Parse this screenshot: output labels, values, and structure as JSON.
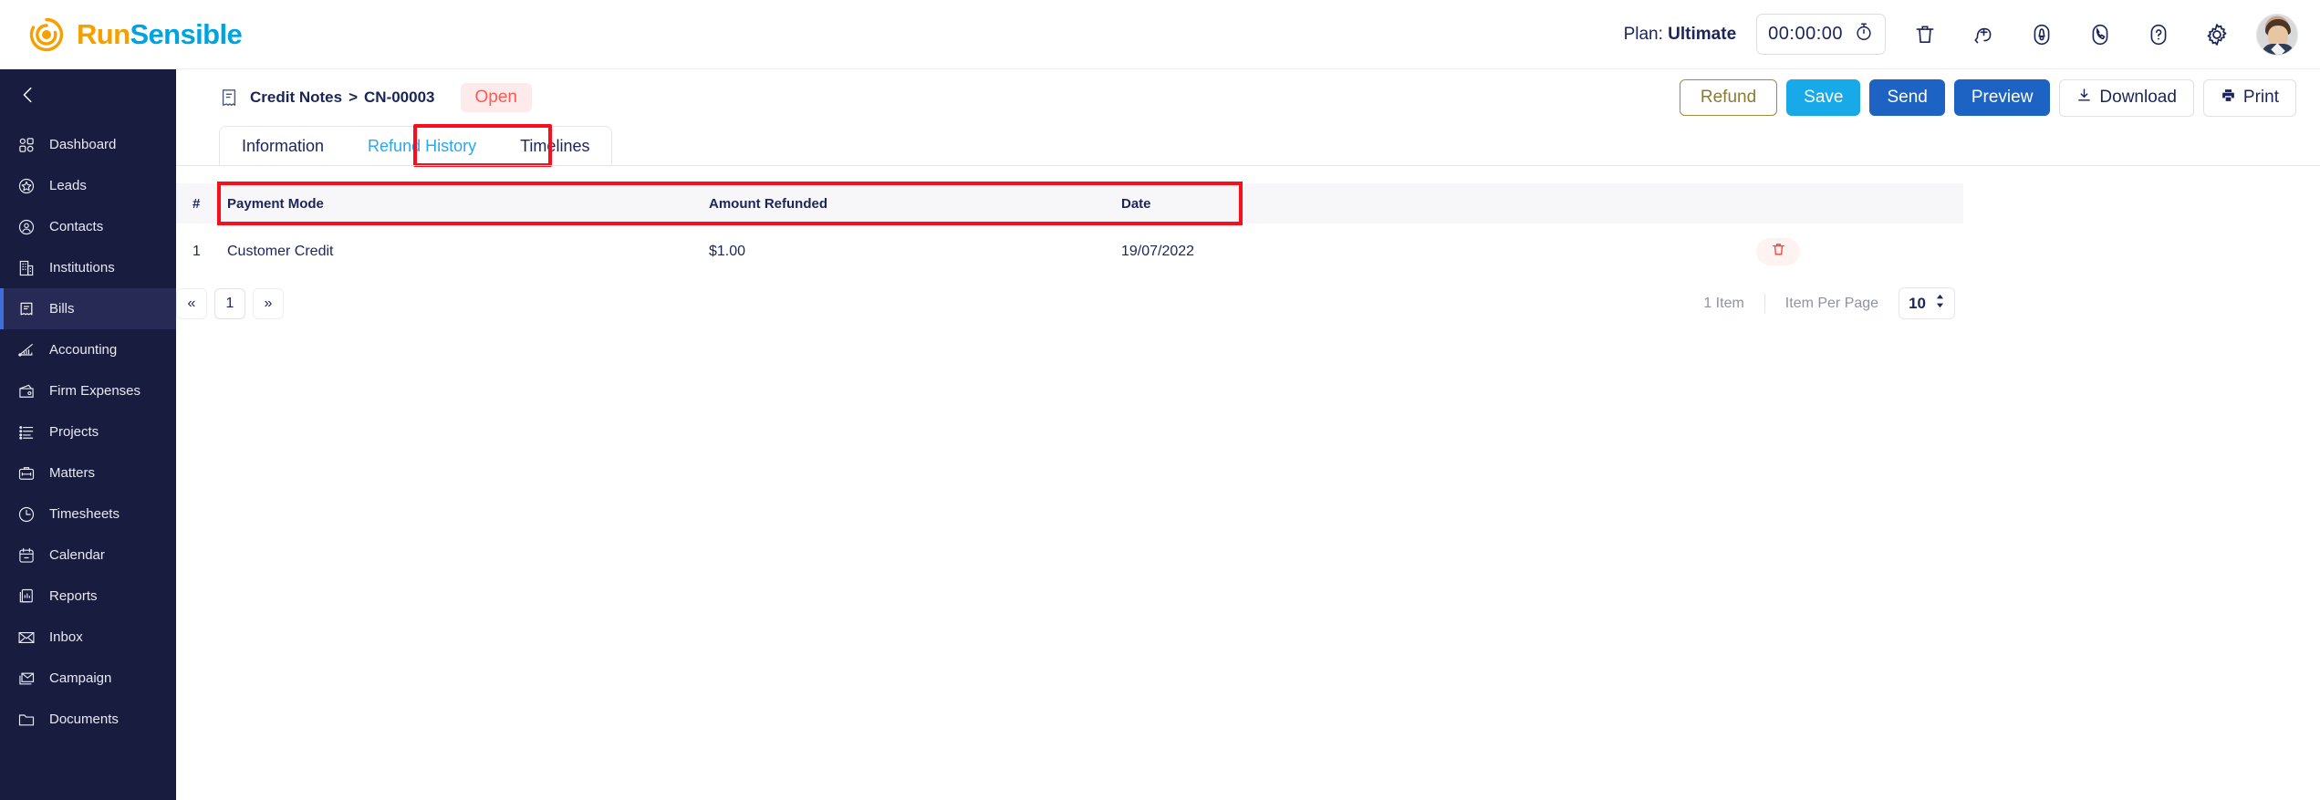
{
  "brand": {
    "name_part1": "Run",
    "name_part2": "Sensible",
    "orange": "#F5A000",
    "blue": "#00A3E0"
  },
  "header": {
    "plan_prefix": "Plan: ",
    "plan_value": "Ultimate",
    "timer_value": "00:00:00",
    "icons": [
      {
        "name": "stopwatch-icon"
      },
      {
        "name": "trash-icon"
      },
      {
        "name": "add-time-icon"
      },
      {
        "name": "notification-bell-icon"
      },
      {
        "name": "phone-icon"
      },
      {
        "name": "help-icon"
      },
      {
        "name": "gear-icon"
      }
    ],
    "avatar_name": "user-avatar"
  },
  "sidebar": {
    "collapse_icon": "chevron-left-icon",
    "active_item": "Bills",
    "items": [
      {
        "label": "Dashboard",
        "icon": "dashboard-icon"
      },
      {
        "label": "Leads",
        "icon": "leads-star-icon"
      },
      {
        "label": "Contacts",
        "icon": "contacts-user-icon"
      },
      {
        "label": "Institutions",
        "icon": "institutions-building-icon"
      },
      {
        "label": "Bills",
        "icon": "bills-receipt-icon"
      },
      {
        "label": "Accounting",
        "icon": "accounting-chart-icon"
      },
      {
        "label": "Firm Expenses",
        "icon": "firm-expenses-wallet-icon"
      },
      {
        "label": "Projects",
        "icon": "projects-list-icon"
      },
      {
        "label": "Matters",
        "icon": "matters-briefcase-icon"
      },
      {
        "label": "Timesheets",
        "icon": "timesheets-clock-icon"
      },
      {
        "label": "Calendar",
        "icon": "calendar-icon"
      },
      {
        "label": "Reports",
        "icon": "reports-icon"
      },
      {
        "label": "Inbox",
        "icon": "inbox-envelope-icon"
      },
      {
        "label": "Campaign",
        "icon": "campaign-mail-icon"
      },
      {
        "label": "Documents",
        "icon": "documents-folder-icon"
      }
    ]
  },
  "breadcrumb": {
    "icon": "credit-note-icon",
    "root": "Credit Notes",
    "separator": ">",
    "current": "CN-00003",
    "status": "Open",
    "status_color": "#ff5a52"
  },
  "actions": [
    {
      "label": "Refund",
      "name": "refund-button",
      "style": "refund"
    },
    {
      "label": "Save",
      "name": "save-button",
      "style": "save"
    },
    {
      "label": "Send",
      "name": "send-button",
      "style": "send"
    },
    {
      "label": "Preview",
      "name": "preview-button",
      "style": "preview"
    },
    {
      "label": "Download",
      "name": "download-button",
      "style": "plain",
      "icon": "download-icon"
    },
    {
      "label": "Print",
      "name": "print-button",
      "style": "plain",
      "icon": "printer-icon"
    }
  ],
  "tabs": [
    {
      "label": "Information",
      "active": false
    },
    {
      "label": "Refund History",
      "active": true
    },
    {
      "label": "Timelines",
      "active": false
    }
  ],
  "table": {
    "columns": [
      "#",
      "Payment Mode",
      "Amount Refunded",
      "Date",
      ""
    ],
    "rows": [
      {
        "num": "1",
        "payment_mode": "Customer Credit",
        "amount_refunded": "$1.00",
        "date": "19/07/2022",
        "delete_icon": "trash-icon"
      }
    ]
  },
  "pagination": {
    "prev": "«",
    "current_page": "1",
    "next": "»",
    "item_count": "1 Item",
    "per_page_label": "Item Per Page",
    "per_page_value": "10"
  }
}
